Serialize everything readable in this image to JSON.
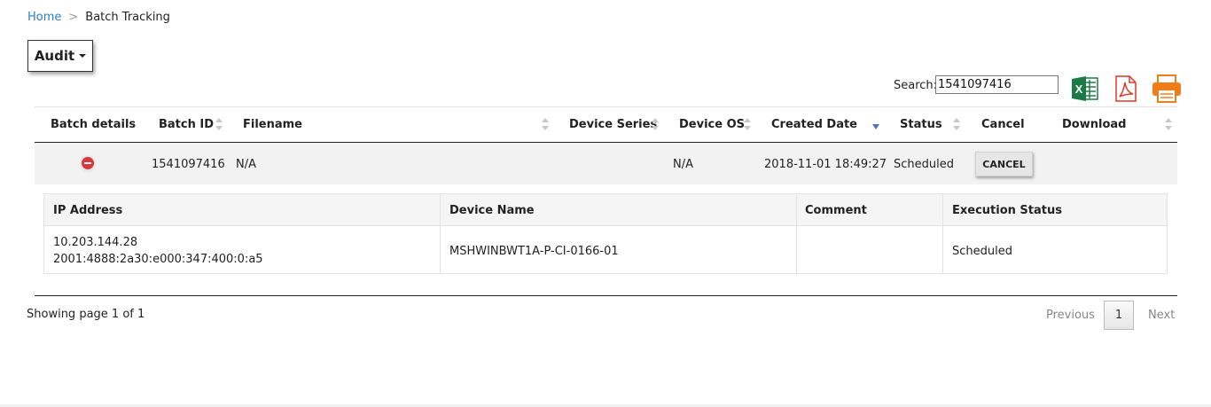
{
  "breadcrumb": {
    "home": "Home",
    "separator": ">",
    "current": "Batch Tracking"
  },
  "audit_button": {
    "label": "Audit"
  },
  "search": {
    "label": "Search:",
    "value": "1541097416"
  },
  "export_icons": [
    "excel-icon",
    "pdf-icon",
    "print-icon"
  ],
  "table": {
    "headers": {
      "batch_details": "Batch details",
      "batch_id": "Batch ID",
      "filename": "Filename",
      "device_series": "Device Series",
      "device_os": "Device OS",
      "created_date": "Created Date",
      "status": "Status",
      "cancel": "Cancel",
      "download": "Download"
    },
    "sorted_column": "created_date",
    "sort_direction": "descending",
    "row": {
      "batch_id": "1541097416",
      "filename": "N/A",
      "device_series": "",
      "device_os": "N/A",
      "created_date": "2018-11-01 18:49:27",
      "status": "Scheduled",
      "cancel_label": "CANCEL",
      "download": ""
    }
  },
  "details": {
    "headers": {
      "ip_address": "IP Address",
      "device_name": "Device Name",
      "comment": "Comment",
      "execution_status": "Execution Status"
    },
    "row": {
      "ipv4": "10.203.144.28",
      "ipv6": "2001:4888:2a30:e000:347:400:0:a5",
      "device_name": "MSHWINBWT1A-P-CI-0166-01",
      "comment": "",
      "execution_status": "Scheduled"
    }
  },
  "pagination": {
    "showing": "Showing page 1 of 1",
    "previous": "Previous",
    "page": "1",
    "next": "Next"
  },
  "colors": {
    "link": "#2a7fc9",
    "remove": "#d9363e",
    "excel": "#1d7a45",
    "pdf": "#d93a2b",
    "print": "#f07c1a",
    "sort_active": "#5b6fc2"
  }
}
